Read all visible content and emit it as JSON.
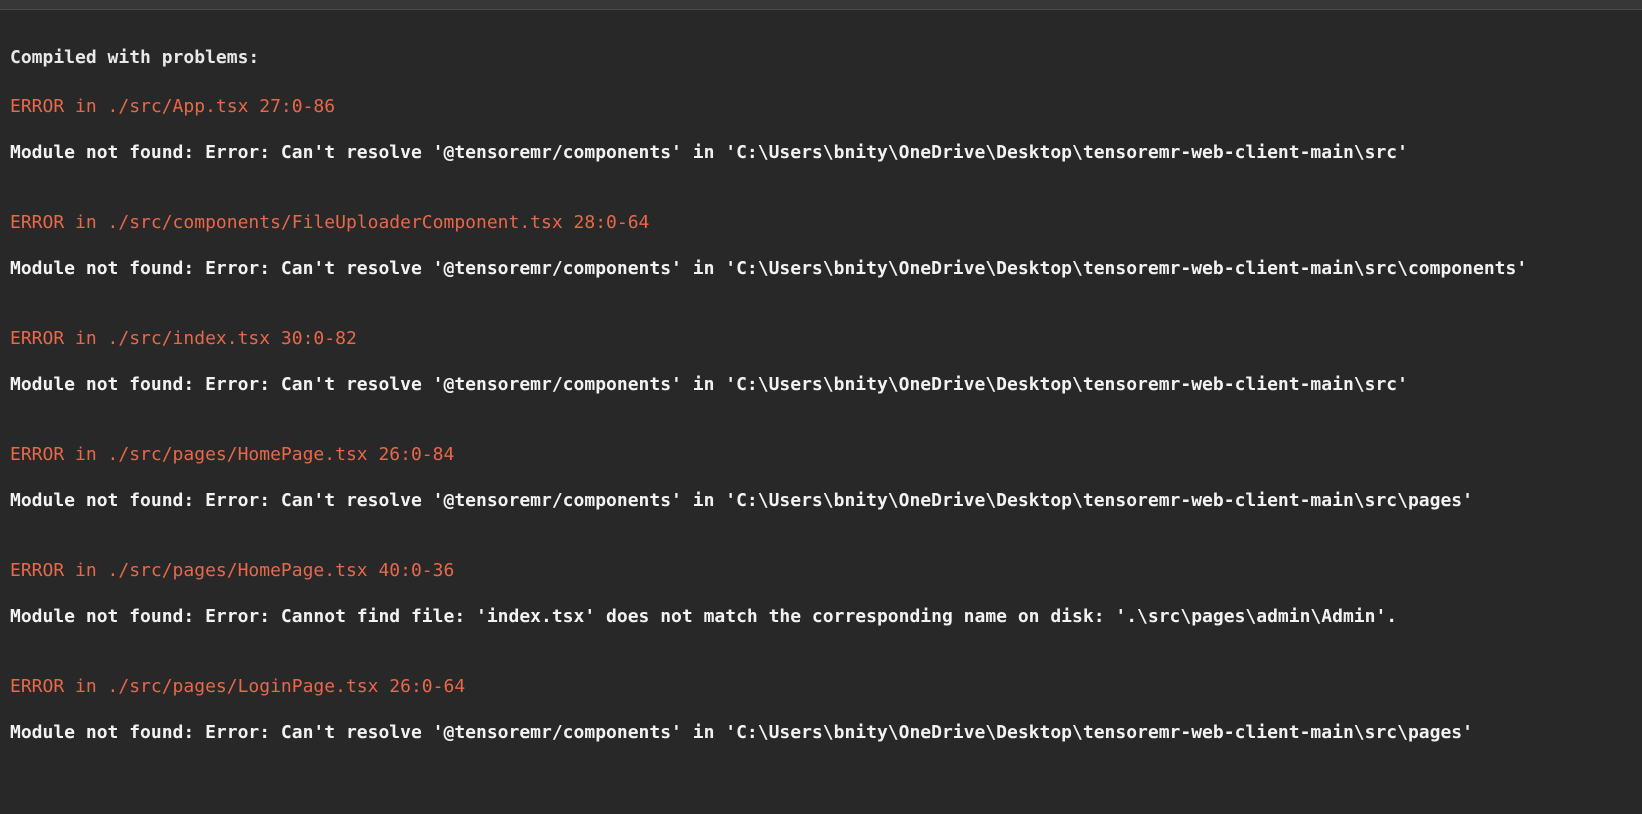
{
  "overlay": {
    "heading": "Compiled with problems:",
    "errors": [
      {
        "title": "ERROR in ./src/App.tsx 27:0-86",
        "message": "Module not found: Error: Can't resolve '@tensoremr/components' in 'C:\\Users\\bnity\\OneDrive\\Desktop\\tensoremr-web-client-main\\src'"
      },
      {
        "title": "ERROR in ./src/components/FileUploaderComponent.tsx 28:0-64",
        "message": "Module not found: Error: Can't resolve '@tensoremr/components' in 'C:\\Users\\bnity\\OneDrive\\Desktop\\tensoremr-web-client-main\\src\\components'"
      },
      {
        "title": "ERROR in ./src/index.tsx 30:0-82",
        "message": "Module not found: Error: Can't resolve '@tensoremr/components' in 'C:\\Users\\bnity\\OneDrive\\Desktop\\tensoremr-web-client-main\\src'"
      },
      {
        "title": "ERROR in ./src/pages/HomePage.tsx 26:0-84",
        "message": "Module not found: Error: Can't resolve '@tensoremr/components' in 'C:\\Users\\bnity\\OneDrive\\Desktop\\tensoremr-web-client-main\\src\\pages'"
      },
      {
        "title": "ERROR in ./src/pages/HomePage.tsx 40:0-36",
        "message": "Module not found: Error: Cannot find file: 'index.tsx' does not match the corresponding name on disk: '.\\src\\pages\\admin\\Admin'."
      },
      {
        "title": "ERROR in ./src/pages/LoginPage.tsx 26:0-64",
        "message": "Module not found: Error: Can't resolve '@tensoremr/components' in 'C:\\Users\\bnity\\OneDrive\\Desktop\\tensoremr-web-client-main\\src\\pages'"
      }
    ]
  }
}
